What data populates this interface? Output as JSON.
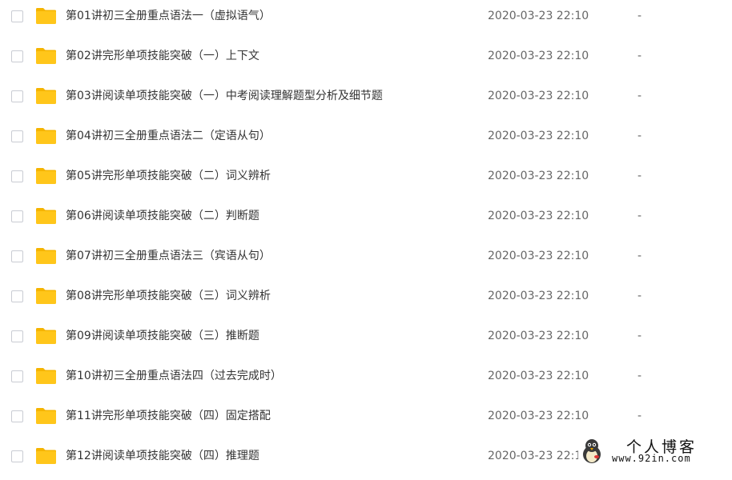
{
  "files": [
    {
      "name": "第01讲初三全册重点语法一（虚拟语气）",
      "date": "2020-03-23 22:10",
      "size": "-"
    },
    {
      "name": "第02讲完形单项技能突破（一）上下文",
      "date": "2020-03-23 22:10",
      "size": "-"
    },
    {
      "name": "第03讲阅读单项技能突破（一）中考阅读理解题型分析及细节题",
      "date": "2020-03-23 22:10",
      "size": "-"
    },
    {
      "name": "第04讲初三全册重点语法二（定语从句）",
      "date": "2020-03-23 22:10",
      "size": "-"
    },
    {
      "name": "第05讲完形单项技能突破（二）词义辨析",
      "date": "2020-03-23 22:10",
      "size": "-"
    },
    {
      "name": "第06讲阅读单项技能突破（二）判断题",
      "date": "2020-03-23 22:10",
      "size": "-"
    },
    {
      "name": "第07讲初三全册重点语法三（宾语从句）",
      "date": "2020-03-23 22:10",
      "size": "-"
    },
    {
      "name": "第08讲完形单项技能突破（三）词义辨析",
      "date": "2020-03-23 22:10",
      "size": "-"
    },
    {
      "name": "第09讲阅读单项技能突破（三）推断题",
      "date": "2020-03-23 22:10",
      "size": "-"
    },
    {
      "name": "第10讲初三全册重点语法四（过去完成时）",
      "date": "2020-03-23 22:10",
      "size": "-"
    },
    {
      "name": "第11讲完形单项技能突破（四）固定搭配",
      "date": "2020-03-23 22:10",
      "size": "-"
    },
    {
      "name": "第12讲阅读单项技能突破（四）推理题",
      "date": "2020-03-23 22:10",
      "size": "-"
    }
  ],
  "watermark": {
    "title": "个人博客",
    "url": "www.92in.com"
  },
  "colors": {
    "folder": "#FFC61A",
    "folder_tab": "#F5B400",
    "text": "#333333",
    "meta": "#666666"
  },
  "icons": {
    "row": "folder-icon",
    "select": "checkbox-icon"
  }
}
